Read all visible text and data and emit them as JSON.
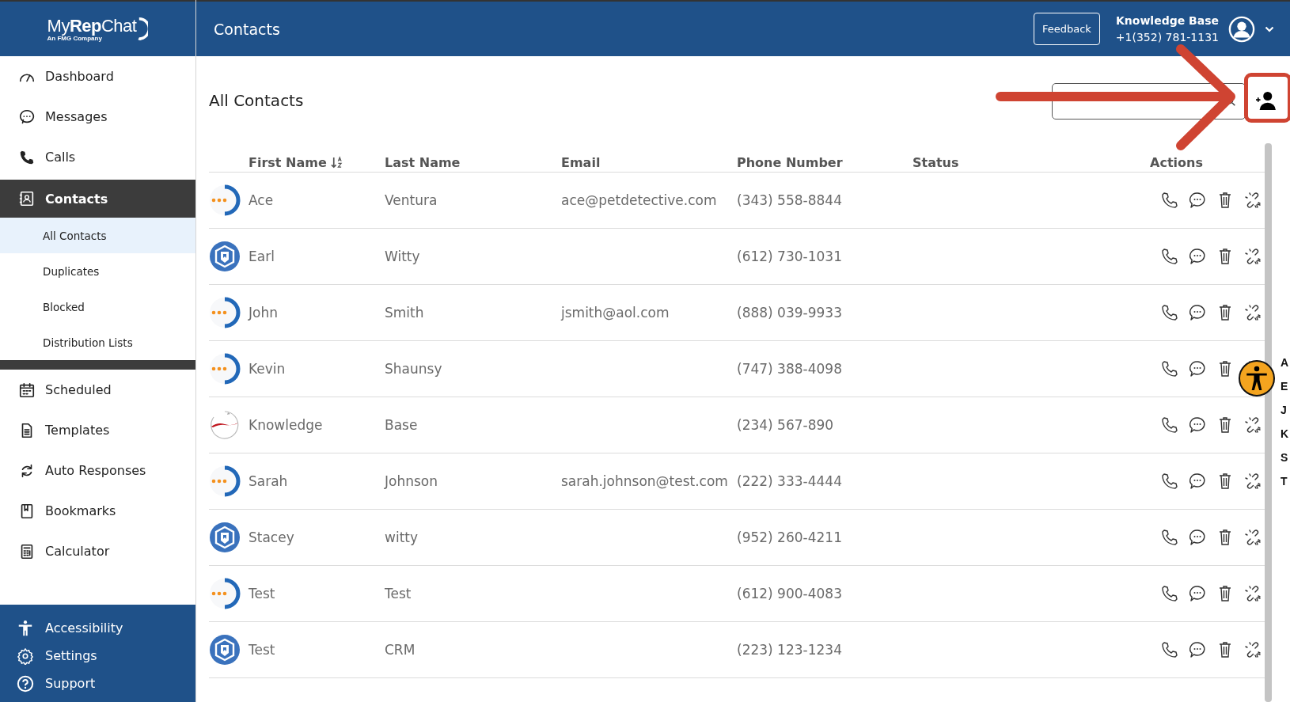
{
  "logo": {
    "name_light": "My",
    "name_bold": "Rep",
    "name_end": "Chat",
    "tagline": "An FMG Company"
  },
  "header": {
    "title": "Contacts",
    "feedback": "Feedback",
    "account_name": "Knowledge Base",
    "account_phone": "+1(352) 781-1131"
  },
  "sidebar": {
    "items": [
      {
        "label": "Dashboard",
        "selected": false
      },
      {
        "label": "Messages",
        "selected": false
      },
      {
        "label": "Calls",
        "selected": false
      },
      {
        "label": "Contacts",
        "selected": true,
        "children": [
          {
            "label": "All Contacts",
            "selected": true
          },
          {
            "label": "Duplicates",
            "selected": false
          },
          {
            "label": "Blocked",
            "selected": false
          },
          {
            "label": "Distribution Lists",
            "selected": false
          }
        ]
      },
      {
        "label": "Scheduled",
        "selected": false
      },
      {
        "label": "Templates",
        "selected": false
      },
      {
        "label": "Auto Responses",
        "selected": false
      },
      {
        "label": "Bookmarks",
        "selected": false
      },
      {
        "label": "Calculator",
        "selected": false
      }
    ],
    "footer": [
      {
        "label": "Accessibility"
      },
      {
        "label": "Settings"
      },
      {
        "label": "Support"
      }
    ]
  },
  "page": {
    "title": "All Contacts"
  },
  "table": {
    "columns": [
      {
        "label": "First Name",
        "sorted": true
      },
      {
        "label": "Last Name",
        "sorted": false
      },
      {
        "label": "Email",
        "sorted": false
      },
      {
        "label": "Phone Number",
        "sorted": false
      },
      {
        "label": "Status",
        "sorted": false
      },
      {
        "label": "Actions",
        "sorted": false
      }
    ],
    "rows": [
      {
        "kind": "dots",
        "first": "Ace",
        "last": "Ventura",
        "email": "ace@petdetective.com",
        "phone": "(343) 558-8844"
      },
      {
        "kind": "hexagon",
        "first": "Earl",
        "last": "Witty",
        "phone": "(612) 730-1031"
      },
      {
        "kind": "dots",
        "first": "John",
        "last": "Smith",
        "email": "jsmith@aol.com",
        "phone": "(888) 039-9933"
      },
      {
        "kind": "dots",
        "first": "Kevin",
        "last": "Shaunsy",
        "phone": "(747) 388-4098"
      },
      {
        "kind": "swoosh",
        "first": "Knowledge",
        "last": "Base",
        "phone": "(234) 567-890"
      },
      {
        "kind": "dots",
        "first": "Sarah",
        "last": "Johnson",
        "email": "sarah.johnson@test.com",
        "phone": "(222) 333-4444"
      },
      {
        "kind": "hexagon",
        "first": "Stacey",
        "last": "witty",
        "phone": "(952) 260-4211"
      },
      {
        "kind": "dots",
        "first": "Test",
        "last": "Test",
        "phone": "(612) 900-4083"
      },
      {
        "kind": "hexagon",
        "first": "Test",
        "last": "CRM",
        "phone": "(223) 123-1234"
      }
    ]
  },
  "alphabet": [
    "A",
    "E",
    "J",
    "K",
    "S",
    "T"
  ]
}
